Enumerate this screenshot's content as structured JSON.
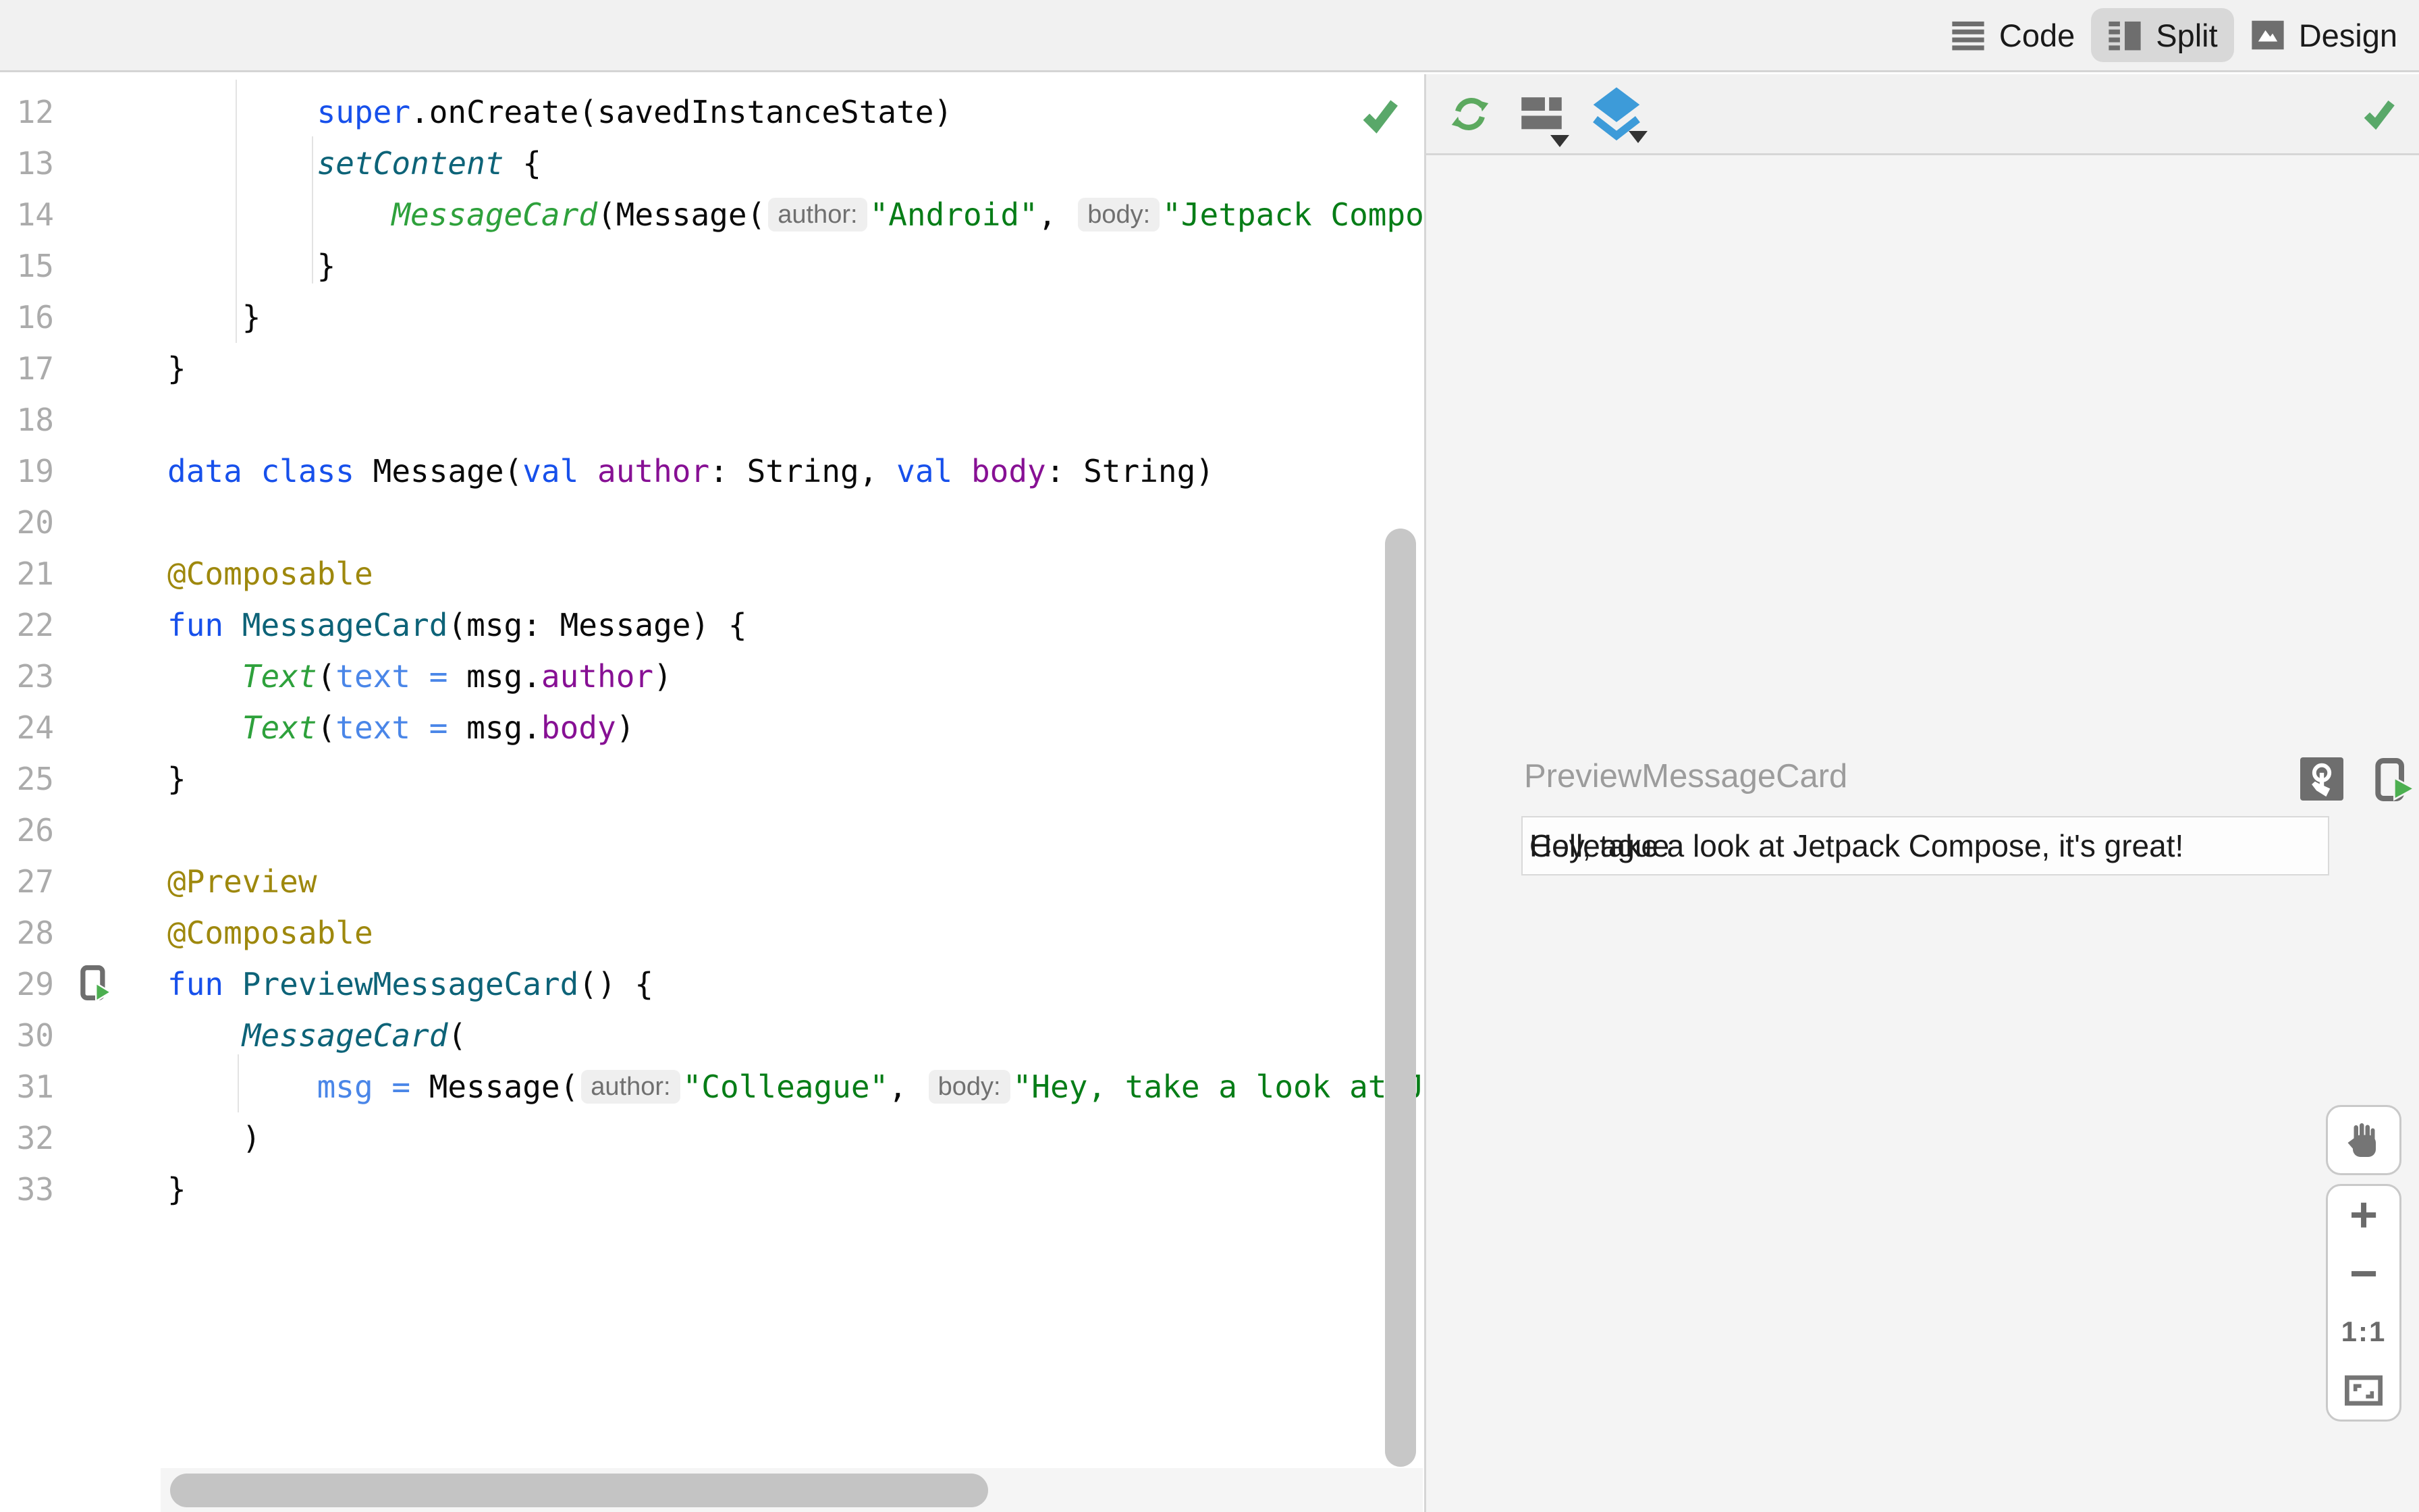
{
  "topbar": {
    "tabs": [
      {
        "id": "code",
        "label": "Code",
        "active": false
      },
      {
        "id": "split",
        "label": "Split",
        "active": true
      },
      {
        "id": "design",
        "label": "Design",
        "active": false
      }
    ]
  },
  "colors": {
    "keyword": "#1750EB",
    "function_call": "#0D6378",
    "composable_call": "#2EA13C",
    "string": "#067D17",
    "annotation": "#9E880D",
    "property": "#871094",
    "named_argument": "#4A86E8",
    "status_ok_green": "#59A869",
    "refresh_green": "#5CA95F",
    "layers_blue": "#3D9BD9",
    "run_green": "#4CAF50"
  },
  "editor": {
    "status": "ok",
    "lines": [
      {
        "num": "12",
        "tokens": [
          [
            "ind",
            "        "
          ],
          [
            "kw",
            "super"
          ],
          [
            "pl",
            ".onCreate(savedInstanceState)"
          ]
        ]
      },
      {
        "num": "13",
        "tokens": [
          [
            "ind",
            "        "
          ],
          [
            "fnc",
            "setContent"
          ],
          [
            "pl",
            " {"
          ]
        ]
      },
      {
        "num": "14",
        "tokens": [
          [
            "ind",
            "            "
          ],
          [
            "fng",
            "MessageCard"
          ],
          [
            "pl",
            "(Message("
          ],
          [
            "hint",
            "author:"
          ],
          [
            "str",
            "\"Android\""
          ],
          [
            "pl",
            ", "
          ],
          [
            "hint",
            "body:"
          ],
          [
            "str",
            "\"Jetpack Compose\""
          ]
        ]
      },
      {
        "num": "15",
        "tokens": [
          [
            "ind",
            "        "
          ],
          [
            "pl",
            "}"
          ]
        ]
      },
      {
        "num": "16",
        "tokens": [
          [
            "ind",
            "    "
          ],
          [
            "pl",
            "}"
          ]
        ]
      },
      {
        "num": "17",
        "tokens": [
          [
            "pl",
            "}"
          ]
        ]
      },
      {
        "num": "18",
        "tokens": []
      },
      {
        "num": "19",
        "tokens": [
          [
            "kw",
            "data"
          ],
          [
            "pl",
            " "
          ],
          [
            "kw",
            "class"
          ],
          [
            "pl",
            " Message("
          ],
          [
            "kw",
            "val"
          ],
          [
            "pl",
            " "
          ],
          [
            "prop",
            "author"
          ],
          [
            "pl",
            ": String, "
          ],
          [
            "kw",
            "val"
          ],
          [
            "pl",
            " "
          ],
          [
            "prop",
            "body"
          ],
          [
            "pl",
            ": String)"
          ]
        ]
      },
      {
        "num": "20",
        "tokens": []
      },
      {
        "num": "21",
        "tokens": [
          [
            "ann",
            "@Composable"
          ]
        ]
      },
      {
        "num": "22",
        "tokens": [
          [
            "kw",
            "fun"
          ],
          [
            "pl",
            " "
          ],
          [
            "fnd",
            "MessageCard"
          ],
          [
            "pl",
            "(msg: Message) {"
          ]
        ]
      },
      {
        "num": "23",
        "tokens": [
          [
            "ind",
            "    "
          ],
          [
            "fng",
            "Text"
          ],
          [
            "pl",
            "("
          ],
          [
            "named",
            "text = "
          ],
          [
            "pl",
            "msg."
          ],
          [
            "prop",
            "author"
          ],
          [
            "pl",
            ")"
          ]
        ]
      },
      {
        "num": "24",
        "tokens": [
          [
            "ind",
            "    "
          ],
          [
            "fng",
            "Text"
          ],
          [
            "pl",
            "("
          ],
          [
            "named",
            "text = "
          ],
          [
            "pl",
            "msg."
          ],
          [
            "prop",
            "body"
          ],
          [
            "pl",
            ")"
          ]
        ]
      },
      {
        "num": "25",
        "tokens": [
          [
            "pl",
            "}"
          ]
        ]
      },
      {
        "num": "26",
        "tokens": []
      },
      {
        "num": "27",
        "tokens": [
          [
            "ann",
            "@Preview"
          ]
        ]
      },
      {
        "num": "28",
        "tokens": [
          [
            "ann",
            "@Composable"
          ]
        ]
      },
      {
        "num": "29",
        "run_gutter": true,
        "tokens": [
          [
            "kw",
            "fun"
          ],
          [
            "pl",
            " "
          ],
          [
            "fnd",
            "PreviewMessageCard"
          ],
          [
            "pl",
            "() {"
          ]
        ]
      },
      {
        "num": "30",
        "tokens": [
          [
            "ind",
            "    "
          ],
          [
            "fnc",
            "MessageCard"
          ],
          [
            "pl",
            "("
          ]
        ]
      },
      {
        "num": "31",
        "tokens": [
          [
            "ind",
            "        "
          ],
          [
            "named",
            "msg = "
          ],
          [
            "pl",
            "Message("
          ],
          [
            "hint",
            "author:"
          ],
          [
            "str",
            "\"Colleague\""
          ],
          [
            "pl",
            ", "
          ],
          [
            "hint",
            "body:"
          ],
          [
            "str",
            "\"Hey, take a look at Jetpack Compose, it's great!\""
          ]
        ]
      },
      {
        "num": "32",
        "tokens": [
          [
            "ind",
            "    "
          ],
          [
            "pl",
            ")"
          ]
        ]
      },
      {
        "num": "33",
        "tokens": [
          [
            "pl",
            "}"
          ]
        ]
      }
    ]
  },
  "preview": {
    "title": "PreviewMessageCard",
    "status": "ok",
    "message_texts": [
      "Colleague",
      "Hey, take a look at Jetpack Compose, it's great!"
    ],
    "controls": {
      "zoom_in": "+",
      "zoom_out": "−",
      "zoom_reset": "1:1"
    }
  }
}
